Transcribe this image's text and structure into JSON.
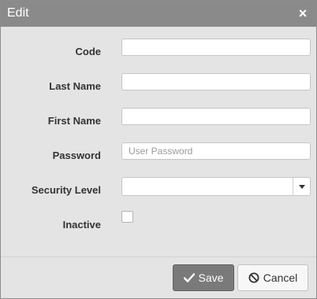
{
  "dialog": {
    "title": "Edit",
    "close_glyph": "×",
    "close_icon": "close-icon"
  },
  "form": {
    "code": {
      "label": "Code",
      "value": "",
      "placeholder": ""
    },
    "last_name": {
      "label": "Last Name",
      "value": "",
      "placeholder": ""
    },
    "first_name": {
      "label": "First Name",
      "value": "",
      "placeholder": ""
    },
    "password": {
      "label": "Password",
      "value": "",
      "placeholder": "User Password"
    },
    "security_level": {
      "label": "Security Level",
      "value": ""
    },
    "inactive": {
      "label": "Inactive",
      "checked": false
    }
  },
  "buttons": {
    "save": {
      "label": "Save",
      "icon": "checkmark-icon"
    },
    "cancel": {
      "label": "Cancel",
      "icon": "ban-icon"
    }
  },
  "colors": {
    "titlebar": "#8a8a8a",
    "dialog_bg": "#e4e4e4",
    "save_bg": "#7a7a7a"
  }
}
